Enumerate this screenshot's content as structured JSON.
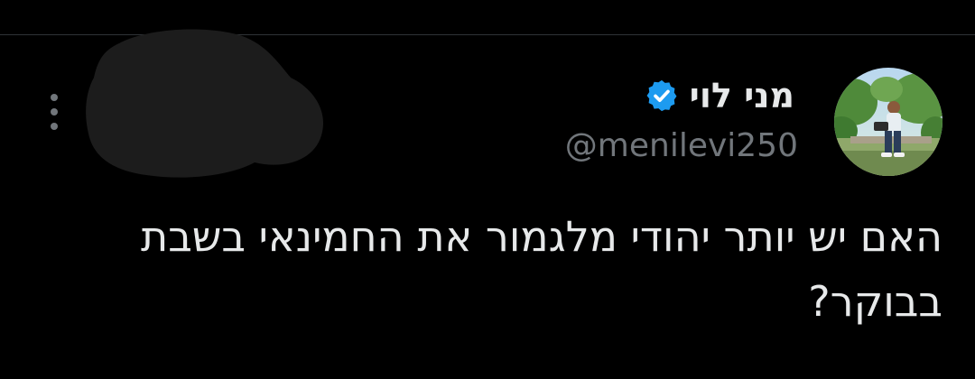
{
  "tweet": {
    "author": {
      "display_name": "מני לוי",
      "handle": "@menilevi250",
      "verified": true,
      "verified_icon": "verified-badge-icon",
      "avatar_icon": "avatar-photo"
    },
    "text": "האם יש יותר יהודי מלגמור את החמינאי בשבת\nבבוקר?",
    "more_icon": "more-vertical-icon",
    "redacted_area": "redacted-blob"
  },
  "colors": {
    "background": "#000000",
    "text_primary": "#e7e9ea",
    "text_secondary": "#71767b",
    "verified_blue": "#1d9bf0",
    "divider": "#2f3336",
    "redaction": "#1c1c1c"
  }
}
